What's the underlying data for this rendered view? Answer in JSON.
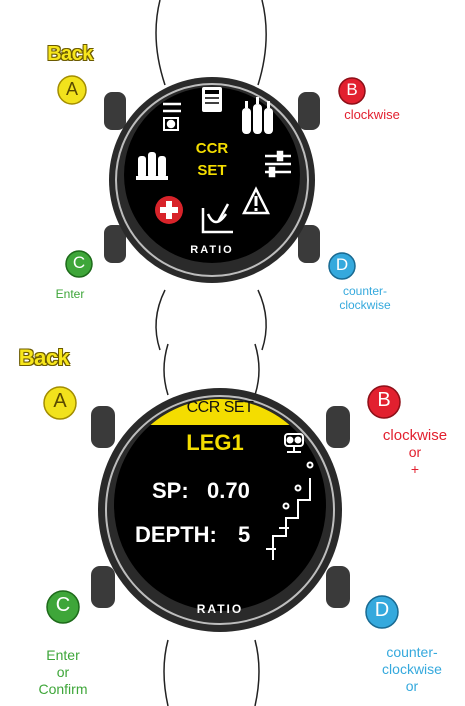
{
  "colors": {
    "button_a": "#f2e21c",
    "button_b": "#e2202f",
    "button_c": "#3ea639",
    "button_d": "#35a9dd",
    "screen_yellow": "#f4dd00"
  },
  "watch1": {
    "buttons": {
      "a": {
        "letter": "A",
        "label": "Back"
      },
      "b": {
        "letter": "B",
        "label": "clockwise"
      },
      "c": {
        "letter": "C",
        "label": "Enter"
      },
      "d": {
        "letter": "D",
        "label_line1": "counter-",
        "label_line2": "clockwise"
      }
    },
    "screen": {
      "center_line1": "CCR",
      "center_line2": "SET",
      "icons": [
        "settings-sliders-icon",
        "logbook-icon",
        "gas-tanks-icon",
        "sliders-icon",
        "warning-icon",
        "planner-icon",
        "first-aid-icon",
        "multi-tank-icon"
      ]
    },
    "brand": "RATIO"
  },
  "watch2": {
    "buttons": {
      "a": {
        "letter": "A",
        "label": "Back"
      },
      "b": {
        "letter": "B",
        "label_line1": "clockwise",
        "label_line2": "or",
        "label_line3": "+"
      },
      "c": {
        "letter": "C",
        "label_line1": "Enter",
        "label_line2": "or",
        "label_line3": "Confirm"
      },
      "d": {
        "letter": "D",
        "label_line1": "counter-",
        "label_line2": "clockwise",
        "label_line3": "or"
      }
    },
    "screen": {
      "header": "CCR SET",
      "leg": "LEG1",
      "sp_label": "SP:",
      "sp_value": "0.70",
      "depth_label": "DEPTH:",
      "depth_value": "5"
    },
    "brand": "RATIO"
  }
}
